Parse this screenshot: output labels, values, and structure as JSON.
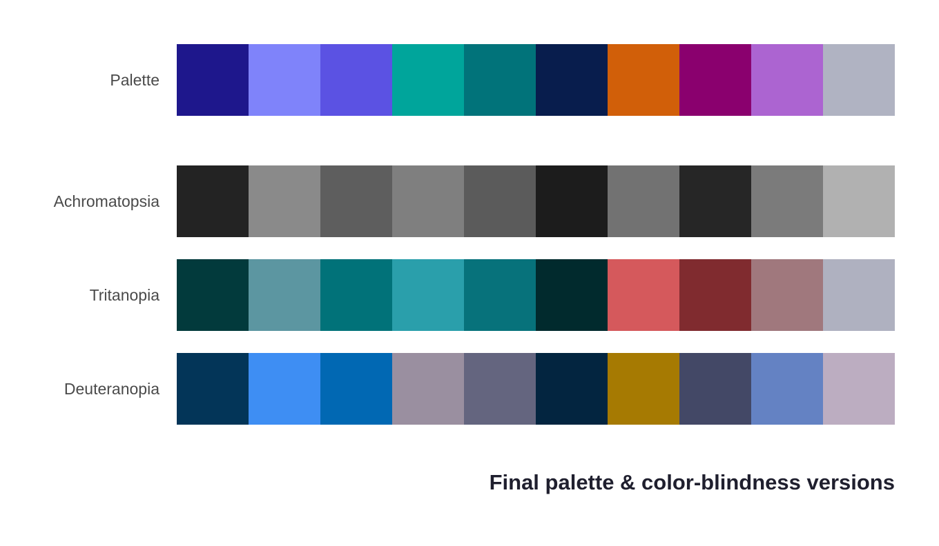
{
  "rows": [
    {
      "label": "Palette",
      "colors": [
        "#1e178c",
        "#7f83fa",
        "#5b52e3",
        "#00a59b",
        "#01737a",
        "#081d4d",
        "#d15f09",
        "#8a006e",
        "#ac64d1",
        "#b0b3c2"
      ]
    },
    {
      "label": "Achromatopsia",
      "colors": [
        "#232323",
        "#8a8a8a",
        "#5e5e5e",
        "#7f7f7f",
        "#5b5b5b",
        "#1c1c1c",
        "#727272",
        "#262626",
        "#7b7b7b",
        "#b1b1b1"
      ]
    },
    {
      "label": "Tritanopia",
      "colors": [
        "#023a3c",
        "#5c96a1",
        "#017279",
        "#2a9fab",
        "#07727b",
        "#012a2d",
        "#d5595c",
        "#802b2f",
        "#a0787d",
        "#afb1c0"
      ]
    },
    {
      "label": "Deuteranopia",
      "colors": [
        "#033558",
        "#3e8ef3",
        "#0168b3",
        "#9a8fa0",
        "#64657f",
        "#032540",
        "#a67a02",
        "#434866",
        "#6482c3",
        "#bcadc1"
      ]
    }
  ],
  "caption": "Final palette & color-blindness versions"
}
